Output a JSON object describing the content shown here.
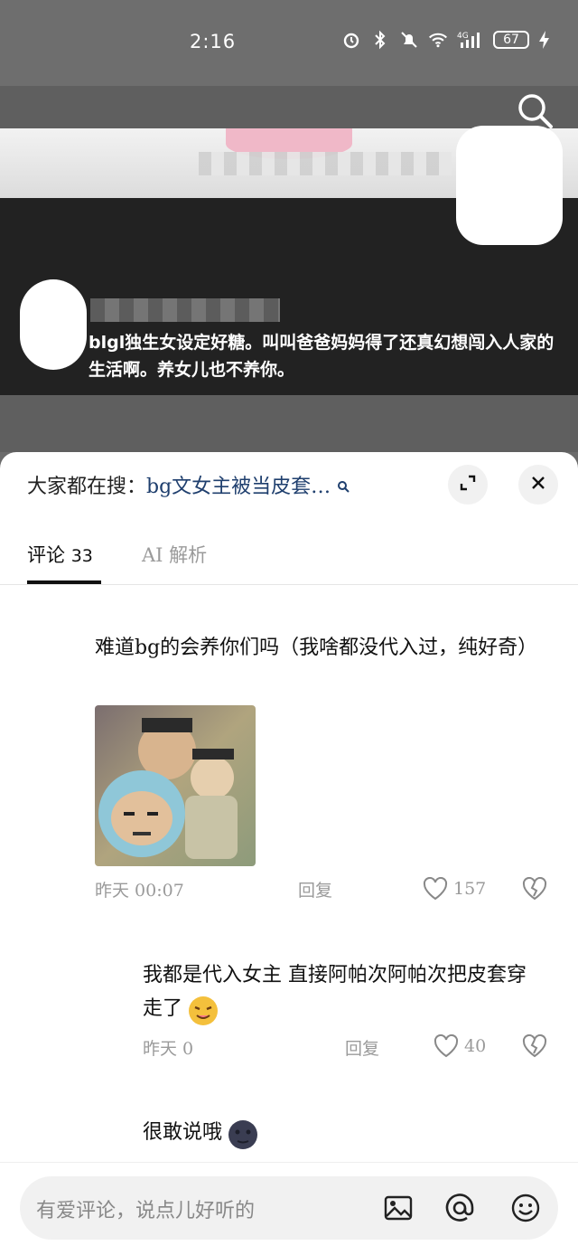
{
  "status": {
    "time": "2:16",
    "signal": "4G",
    "battery": "67"
  },
  "video": {
    "caption": "blgl独生女设定好糖。叫叫爸爸妈妈得了还真幻想闯入人家的生活啊。养女儿也不养你。"
  },
  "sheet": {
    "trending_prefix": "大家都在搜：",
    "trending_query": "bg文女主被当皮套…",
    "tabs": [
      {
        "label": "评论",
        "count": "33"
      },
      {
        "label": "AI 解析"
      }
    ]
  },
  "comments": [
    {
      "text": "难道bg的会养你们吗（我啥都没代入过，纯好奇）",
      "time": "昨天 00:07",
      "reply": "回复",
      "likes": "157",
      "has_image": true
    },
    {
      "text": "我都是代入女主 直接阿帕次阿帕次把皮套穿走了",
      "emoji": "drool-face",
      "time": "昨天 0",
      "reply": "回复",
      "likes": "40"
    },
    {
      "text": "很敢说哦",
      "emoji": "new-moon-face"
    }
  ],
  "input": {
    "placeholder": "有爱评论，说点儿好听的"
  },
  "colors": {
    "link": "#1f3f6e",
    "muted": "#9a9a9a",
    "sheet_bg": "#ffffff",
    "video_dark": "#222222"
  }
}
